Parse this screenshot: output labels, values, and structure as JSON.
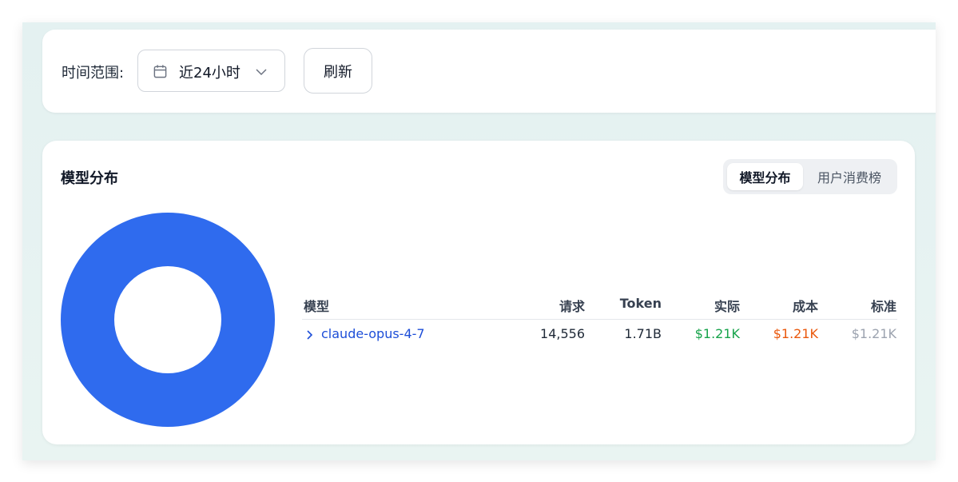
{
  "filter": {
    "label": "时间范围:",
    "range_value": "近24小时",
    "refresh_label": "刷新"
  },
  "panel": {
    "title": "模型分布",
    "tabs": [
      "模型分布",
      "用户消费榜"
    ],
    "active_tab": 0
  },
  "table": {
    "headers": {
      "model": "模型",
      "requests": "请求",
      "token": "Token",
      "actual": "实际",
      "cost": "成本",
      "standard": "标准"
    },
    "rows": [
      {
        "model": "claude-opus-4-7",
        "requests": "14,556",
        "token": "1.71B",
        "actual": "$1.21K",
        "cost": "$1.21K",
        "standard": "$1.21K"
      }
    ]
  },
  "chart_data": {
    "type": "pie",
    "categories": [
      "claude-opus-4-7"
    ],
    "values": [
      100
    ],
    "colors": [
      "#2f6bee"
    ]
  },
  "colors": {
    "accent": "#2f6bee",
    "link": "#1d4ed8",
    "actual": "#16a34a",
    "cost": "#ea580c",
    "standard": "#9ca3af"
  }
}
